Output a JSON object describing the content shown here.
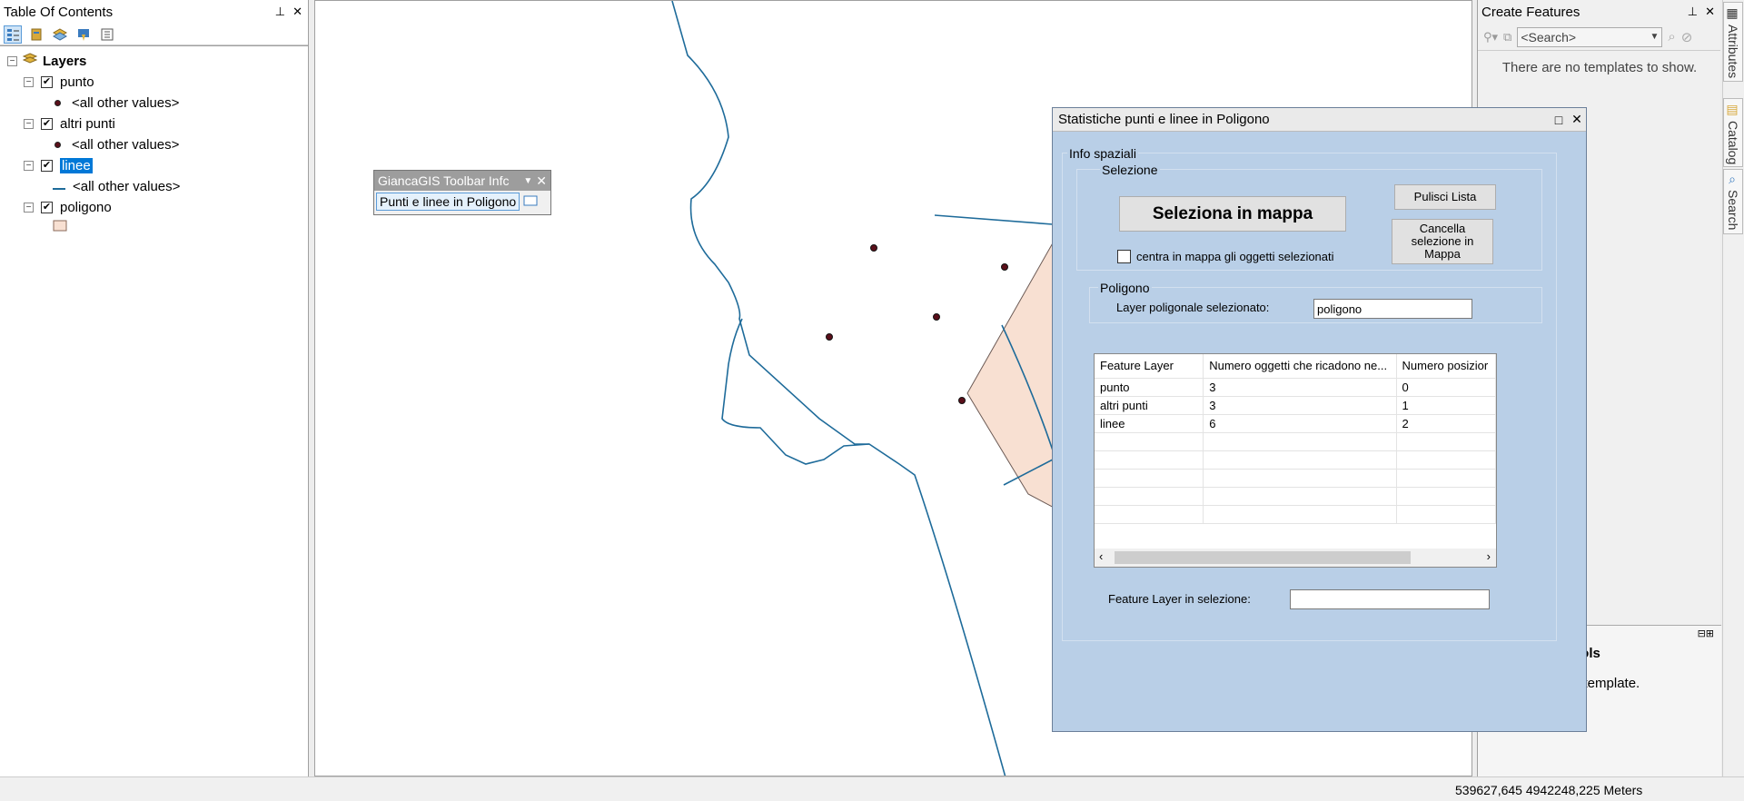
{
  "toc": {
    "title": "Table Of Contents",
    "root": "Layers",
    "layers": [
      {
        "name": "punto",
        "legend": "<all other values>",
        "symbol": "point",
        "selected": false
      },
      {
        "name": "altri punti",
        "legend": "<all other values>",
        "symbol": "point",
        "selected": false
      },
      {
        "name": "linee",
        "legend": "<all other values>",
        "symbol": "line",
        "selected": true
      },
      {
        "name": "poligono",
        "legend": "",
        "symbol": "polygon",
        "selected": false
      }
    ]
  },
  "floating_toolbar": {
    "title": "GiancaGIS Toolbar Infc",
    "tool_label": "Punti e linee in Poligono"
  },
  "create_features": {
    "title": "Create Features",
    "search_placeholder": "<Search>",
    "empty_message": "There are no templates to show.",
    "lower_title": "ools",
    "lower_text": "a template."
  },
  "side_tabs": [
    "Attributes",
    "Catalog",
    "Search"
  ],
  "dialog": {
    "title": "Statistiche punti e linee in Poligono",
    "group_info": "Info spaziali",
    "group_selection": "Selezione",
    "select_button": "Seleziona in mappa",
    "clear_list_button": "Pulisci Lista",
    "clear_selection_button": "Cancella selezione in Mappa",
    "center_checkbox_label": "centra in mappa gli oggetti selezionati",
    "center_checked": false,
    "group_polygon": "Poligono",
    "polygon_layer_label": "Layer poligonale selezionato:",
    "polygon_layer_value": "poligono",
    "grid": {
      "columns": [
        "Feature Layer",
        "Numero oggetti che ricadono ne...",
        "Numero posizior"
      ],
      "rows": [
        [
          "punto",
          "3",
          "0"
        ],
        [
          "altri punti",
          "3",
          "1"
        ],
        [
          "linee",
          "6",
          "2"
        ]
      ]
    },
    "feature_layer_label": "Feature Layer in selezione:",
    "feature_layer_value": ""
  },
  "status": {
    "coordinates": "539627,645  4942248,225 Meters"
  },
  "colors": {
    "polygon_fill": "#f8e0d2",
    "line": "#1e6b9a",
    "point": "#5a0f1a",
    "dialog_bg": "#b9cfe7",
    "selection": "#0078d7"
  }
}
